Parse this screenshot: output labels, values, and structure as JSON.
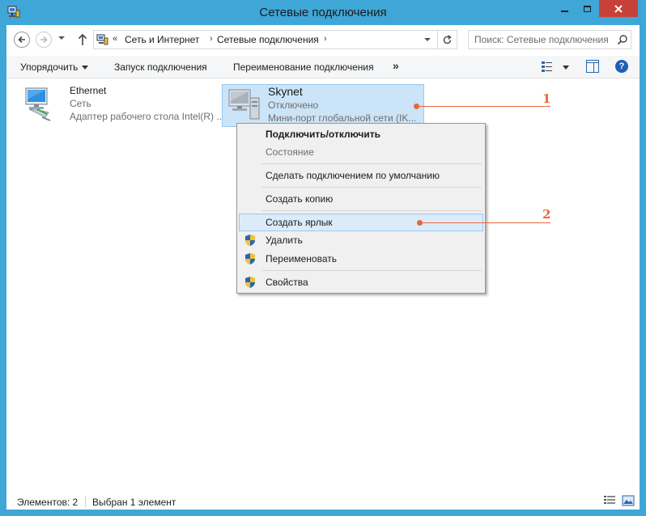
{
  "window": {
    "title": "Сетевые подключения"
  },
  "navigation": {
    "breadcrumb_overflow": "«",
    "breadcrumbs": [
      "Сеть и Интернет",
      "Сетевые подключения"
    ],
    "separator": "›",
    "search_placeholder": "Поиск: Сетевые подключения"
  },
  "commandbar": {
    "organize": "Упорядочить",
    "start_connection": "Запуск подключения",
    "rename_connection": "Переименование подключения",
    "more": "»"
  },
  "connections": [
    {
      "name": "Ethernet",
      "status": "Сеть",
      "device": "Адаптер рабочего стола Intel(R) ...",
      "selected": false
    },
    {
      "name": "Skynet",
      "status": "Отключено",
      "device": "Мини-порт глобальной сети (IK...",
      "selected": true
    }
  ],
  "context_menu": {
    "items": [
      {
        "label": "Подключить/отключить",
        "bold": true,
        "disabled": false,
        "shield": false,
        "highlighted": false
      },
      {
        "label": "Состояние",
        "bold": false,
        "disabled": true,
        "shield": false,
        "highlighted": false
      },
      {
        "label": "Сделать подключением по умолчанию",
        "bold": false,
        "disabled": false,
        "shield": false,
        "highlighted": false
      },
      {
        "label": "Создать копию",
        "bold": false,
        "disabled": false,
        "shield": false,
        "highlighted": false
      },
      {
        "label": "Создать ярлык",
        "bold": false,
        "disabled": false,
        "shield": false,
        "highlighted": true
      },
      {
        "label": "Удалить",
        "bold": false,
        "disabled": false,
        "shield": true,
        "highlighted": false
      },
      {
        "label": "Переименовать",
        "bold": false,
        "disabled": false,
        "shield": true,
        "highlighted": false
      },
      {
        "label": "Свойства",
        "bold": false,
        "disabled": false,
        "shield": true,
        "highlighted": false
      }
    ]
  },
  "annotations": [
    "1",
    "2"
  ],
  "statusbar": {
    "items_count": "Элементов: 2",
    "selected": "Выбран 1 элемент"
  },
  "colors": {
    "window_frame": "#3fa6d8",
    "close_button": "#c7413a",
    "selection": "#cce4f7",
    "annotation": "#e8673c"
  }
}
